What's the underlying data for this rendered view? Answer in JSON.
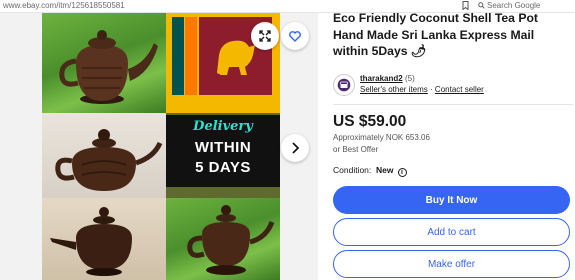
{
  "browser": {
    "url": "www.ebay.com/itm/125618550581",
    "search_placeholder": "Search Google"
  },
  "gallery": {
    "delivery_label": "Delivery",
    "within_label": "WITHIN",
    "days_label": "5 DAYS"
  },
  "listing": {
    "title": "Eco Friendly Coconut Shell Tea Pot Hand Made Sri Lanka Express Mail within 5Days 🌶",
    "seller_name": "tharakand2",
    "seller_score": "(5)",
    "seller_other_items": "Seller's other items",
    "seller_separator": "·",
    "seller_contact": "Contact seller",
    "price": "US $59.00",
    "approx_price": "Approximately NOK 653.06",
    "best_offer": "or Best Offer",
    "condition_label": "Condition:",
    "condition_value": "New"
  },
  "actions": {
    "buy_now": "Buy It Now",
    "add_to_cart": "Add to cart",
    "make_offer": "Make offer"
  },
  "colors": {
    "primary_blue": "#3665f3",
    "flag_maroon": "#8d1d2c",
    "flag_gold": "#f5b800"
  },
  "icons": {
    "expand": "expand-icon",
    "heart": "heart-icon",
    "next": "chevron-right-icon",
    "bookmark": "bookmark-icon",
    "info": "info-icon"
  }
}
